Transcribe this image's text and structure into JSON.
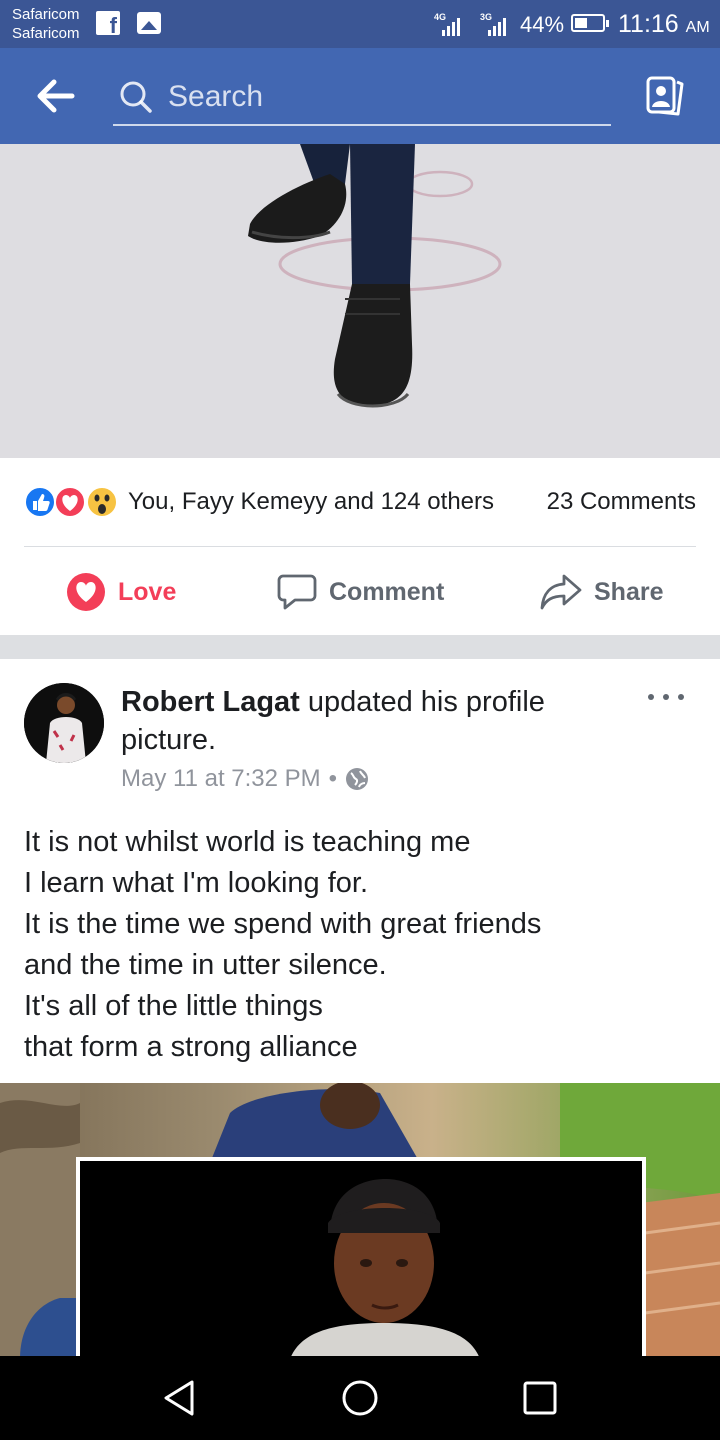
{
  "status_bar": {
    "carrier_1": "Safaricom",
    "carrier_2": "Safaricom",
    "network_1": "4G",
    "network_2": "3G",
    "battery": "44%",
    "time": "11:16",
    "ampm": "AM",
    "icons": [
      "facebook-notification-icon",
      "gallery-notification-icon",
      "signal-icon",
      "battery-icon"
    ]
  },
  "app_bar": {
    "search_placeholder": "Search",
    "color": "#4267b2"
  },
  "post1": {
    "reaction_icons": [
      "like-reaction-icon",
      "love-reaction-icon",
      "wow-reaction-icon"
    ],
    "reaction_summary": "You, Fayy Kemeyy and 124 others",
    "comments_count": "23 Comments",
    "actions": {
      "love": "Love",
      "comment": "Comment",
      "share": "Share"
    },
    "love_color": "#f33e58"
  },
  "post2": {
    "author": "Robert Lagat",
    "action_text": " updated his profile picture.",
    "timestamp": "May 11 at 7:32 PM",
    "separator": "•",
    "caption_lines": [
      "It is not whilst world is teaching me",
      "I learn what I'm looking for.",
      "It is the time we spend with great friends",
      "and the time in utter silence.",
      "It's all of the little things",
      "that form a strong alliance"
    ]
  }
}
